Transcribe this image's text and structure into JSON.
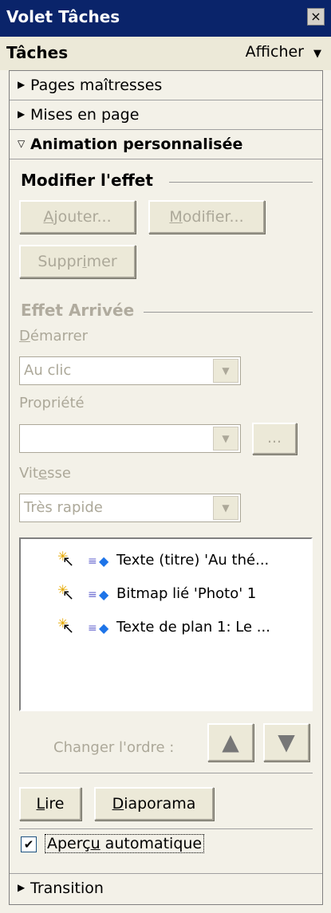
{
  "window": {
    "title": "Volet Tâches",
    "close": "×"
  },
  "header": {
    "title": "Tâches",
    "menu_label": "Afficher",
    "menu_arrow": "▼"
  },
  "sections": {
    "master_pages": "Pages maîtresses",
    "layouts": "Mises en page",
    "custom_animation": "Animation personnalisée",
    "transition": "Transition",
    "collapsed_tri": "▶",
    "expanded_tri": "▽"
  },
  "modify_effect": {
    "title": "Modifier l'effet",
    "add": {
      "pre": "",
      "ul": "A",
      "post": "jouter..."
    },
    "modify": {
      "pre": "",
      "ul": "M",
      "post": "odifier..."
    },
    "remove": {
      "pre": "Suppr",
      "ul": "i",
      "post": "mer"
    }
  },
  "effect": {
    "title": "Effet Arrivée",
    "start_label": {
      "pre": "",
      "ul": "D",
      "post": "émarrer"
    },
    "start_value": "Au clic",
    "property_label": "Propriété",
    "property_value": "",
    "property_more": "...",
    "speed_label": {
      "pre": "Vit",
      "ul": "e",
      "post": "sse"
    },
    "speed_value": "Très rapide",
    "combo_arrow": "▼"
  },
  "effect_list": [
    {
      "label": "Texte (titre) 'Au thé..."
    },
    {
      "label": "Bitmap lié 'Photo' 1"
    },
    {
      "label": "Texte de plan 1: Le ..."
    }
  ],
  "order": {
    "label": "Changer l'ordre :",
    "up": "▲",
    "down": "▼"
  },
  "actions": {
    "play": {
      "pre": "",
      "ul": "L",
      "post": "ire"
    },
    "slideshow": {
      "pre": "",
      "ul": "D",
      "post": "iaporama"
    }
  },
  "auto_preview": {
    "pre": "Aperç",
    "ul": "u",
    "post": " automatique",
    "checked": true,
    "mark": "✔"
  }
}
